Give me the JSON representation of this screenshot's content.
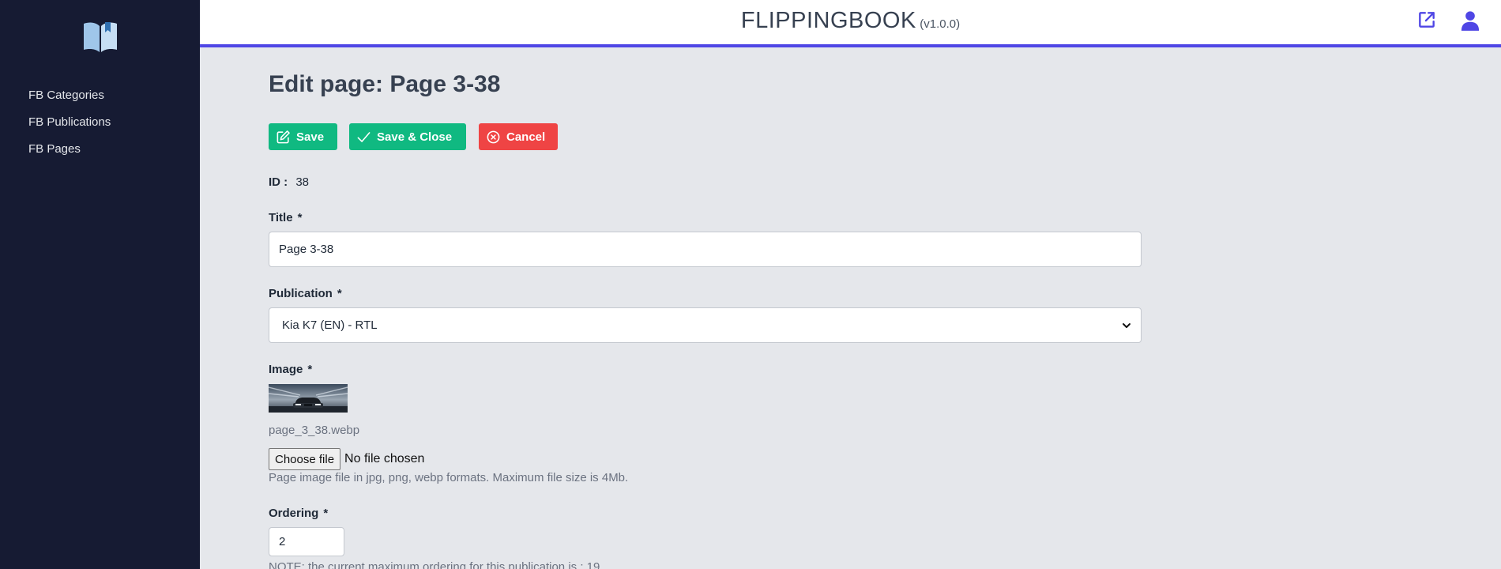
{
  "sidebar": {
    "logo_icon": "open-book-icon",
    "items": [
      {
        "label": "FB Categories"
      },
      {
        "label": "FB Publications"
      },
      {
        "label": "FB Pages"
      }
    ]
  },
  "header": {
    "brand": "FLIPPINGBOOK",
    "version": "(v1.0.0)",
    "accent_color": "#4f46e5",
    "icons": [
      "external-link-icon",
      "user-icon"
    ]
  },
  "page": {
    "title": "Edit page: Page 3-38"
  },
  "toolbar": {
    "save_label": "Save",
    "save_close_label": "Save & Close",
    "cancel_label": "Cancel",
    "save_color": "#10b981",
    "cancel_color": "#ef4444"
  },
  "form": {
    "id_label": "ID :",
    "id_value": "38",
    "required_mark": "*",
    "title_label": "Title",
    "title_value": "Page 3-38",
    "publication_label": "Publication",
    "publication_value": "Kia K7 (EN) - RTL",
    "image_label": "Image",
    "image_filename": "page_3_38.webp",
    "choose_file_label": "Choose file",
    "file_status": "No file chosen",
    "image_help": "Page image file in jpg, png, webp formats. Maximum file size is 4Mb.",
    "ordering_label": "Ordering",
    "ordering_value": "2",
    "ordering_note": "NOTE: the current maximum ordering for this publication is : 19"
  }
}
